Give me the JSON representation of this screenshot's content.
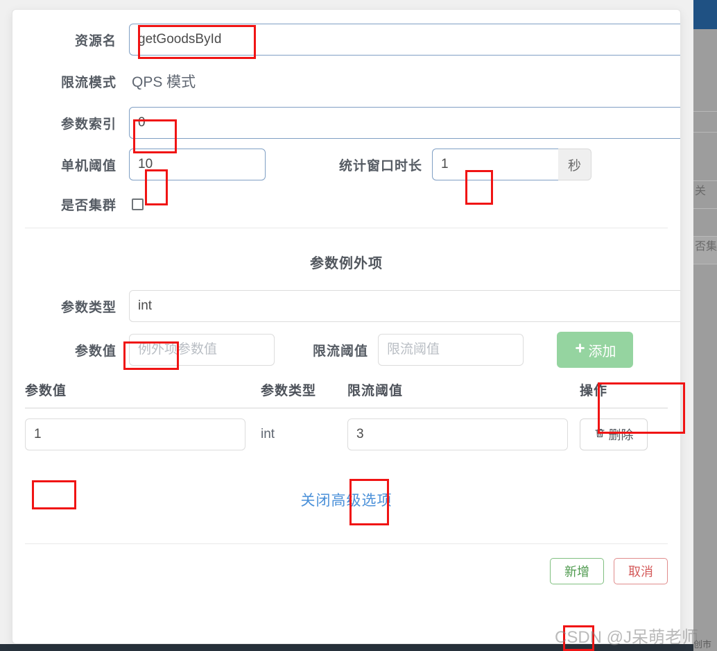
{
  "dialog": {
    "form": {
      "resource_name": {
        "label": "资源名",
        "value": "getGoodsById"
      },
      "flow_mode": {
        "label": "限流模式",
        "value": "QPS 模式"
      },
      "param_index": {
        "label": "参数索引",
        "value": "0"
      },
      "single_threshold": {
        "label": "单机阈值",
        "value": "10"
      },
      "window_duration": {
        "label": "统计窗口时长",
        "value": "1",
        "unit": "秒"
      },
      "is_cluster": {
        "label": "是否集群",
        "checked": false
      }
    },
    "exception_section": {
      "title": "参数例外项",
      "param_type": {
        "label": "参数类型",
        "value": "int"
      },
      "param_value": {
        "label": "参数值",
        "placeholder": "例外项参数值"
      },
      "limit_threshold": {
        "label": "限流阈值",
        "placeholder": "限流阈值"
      },
      "add_button": {
        "label": "添加",
        "icon": "plus-icon"
      }
    },
    "table": {
      "headers": [
        "参数值",
        "参数类型",
        "限流阈值",
        "操作"
      ],
      "rows": [
        {
          "param_value": "1",
          "param_type": "int",
          "limit_threshold": "3",
          "action_label": "删除",
          "action_icon": "trash-icon"
        }
      ]
    },
    "advanced_toggle": {
      "label": "关闭高级选项"
    },
    "footer": {
      "confirm_label": "新增",
      "cancel_label": "取消"
    }
  },
  "background": {
    "right_panel_texts": [
      "关",
      "否集"
    ],
    "bottom_text": "创市"
  },
  "watermark": {
    "text": "CSDN @J呆萌老师"
  },
  "colors": {
    "accent_blue": "#4a90d9",
    "focus_border": "#7f9fc4",
    "add_green": "#95d4a0",
    "annotation_red": "#f01414",
    "label_gray": "#555b63"
  }
}
